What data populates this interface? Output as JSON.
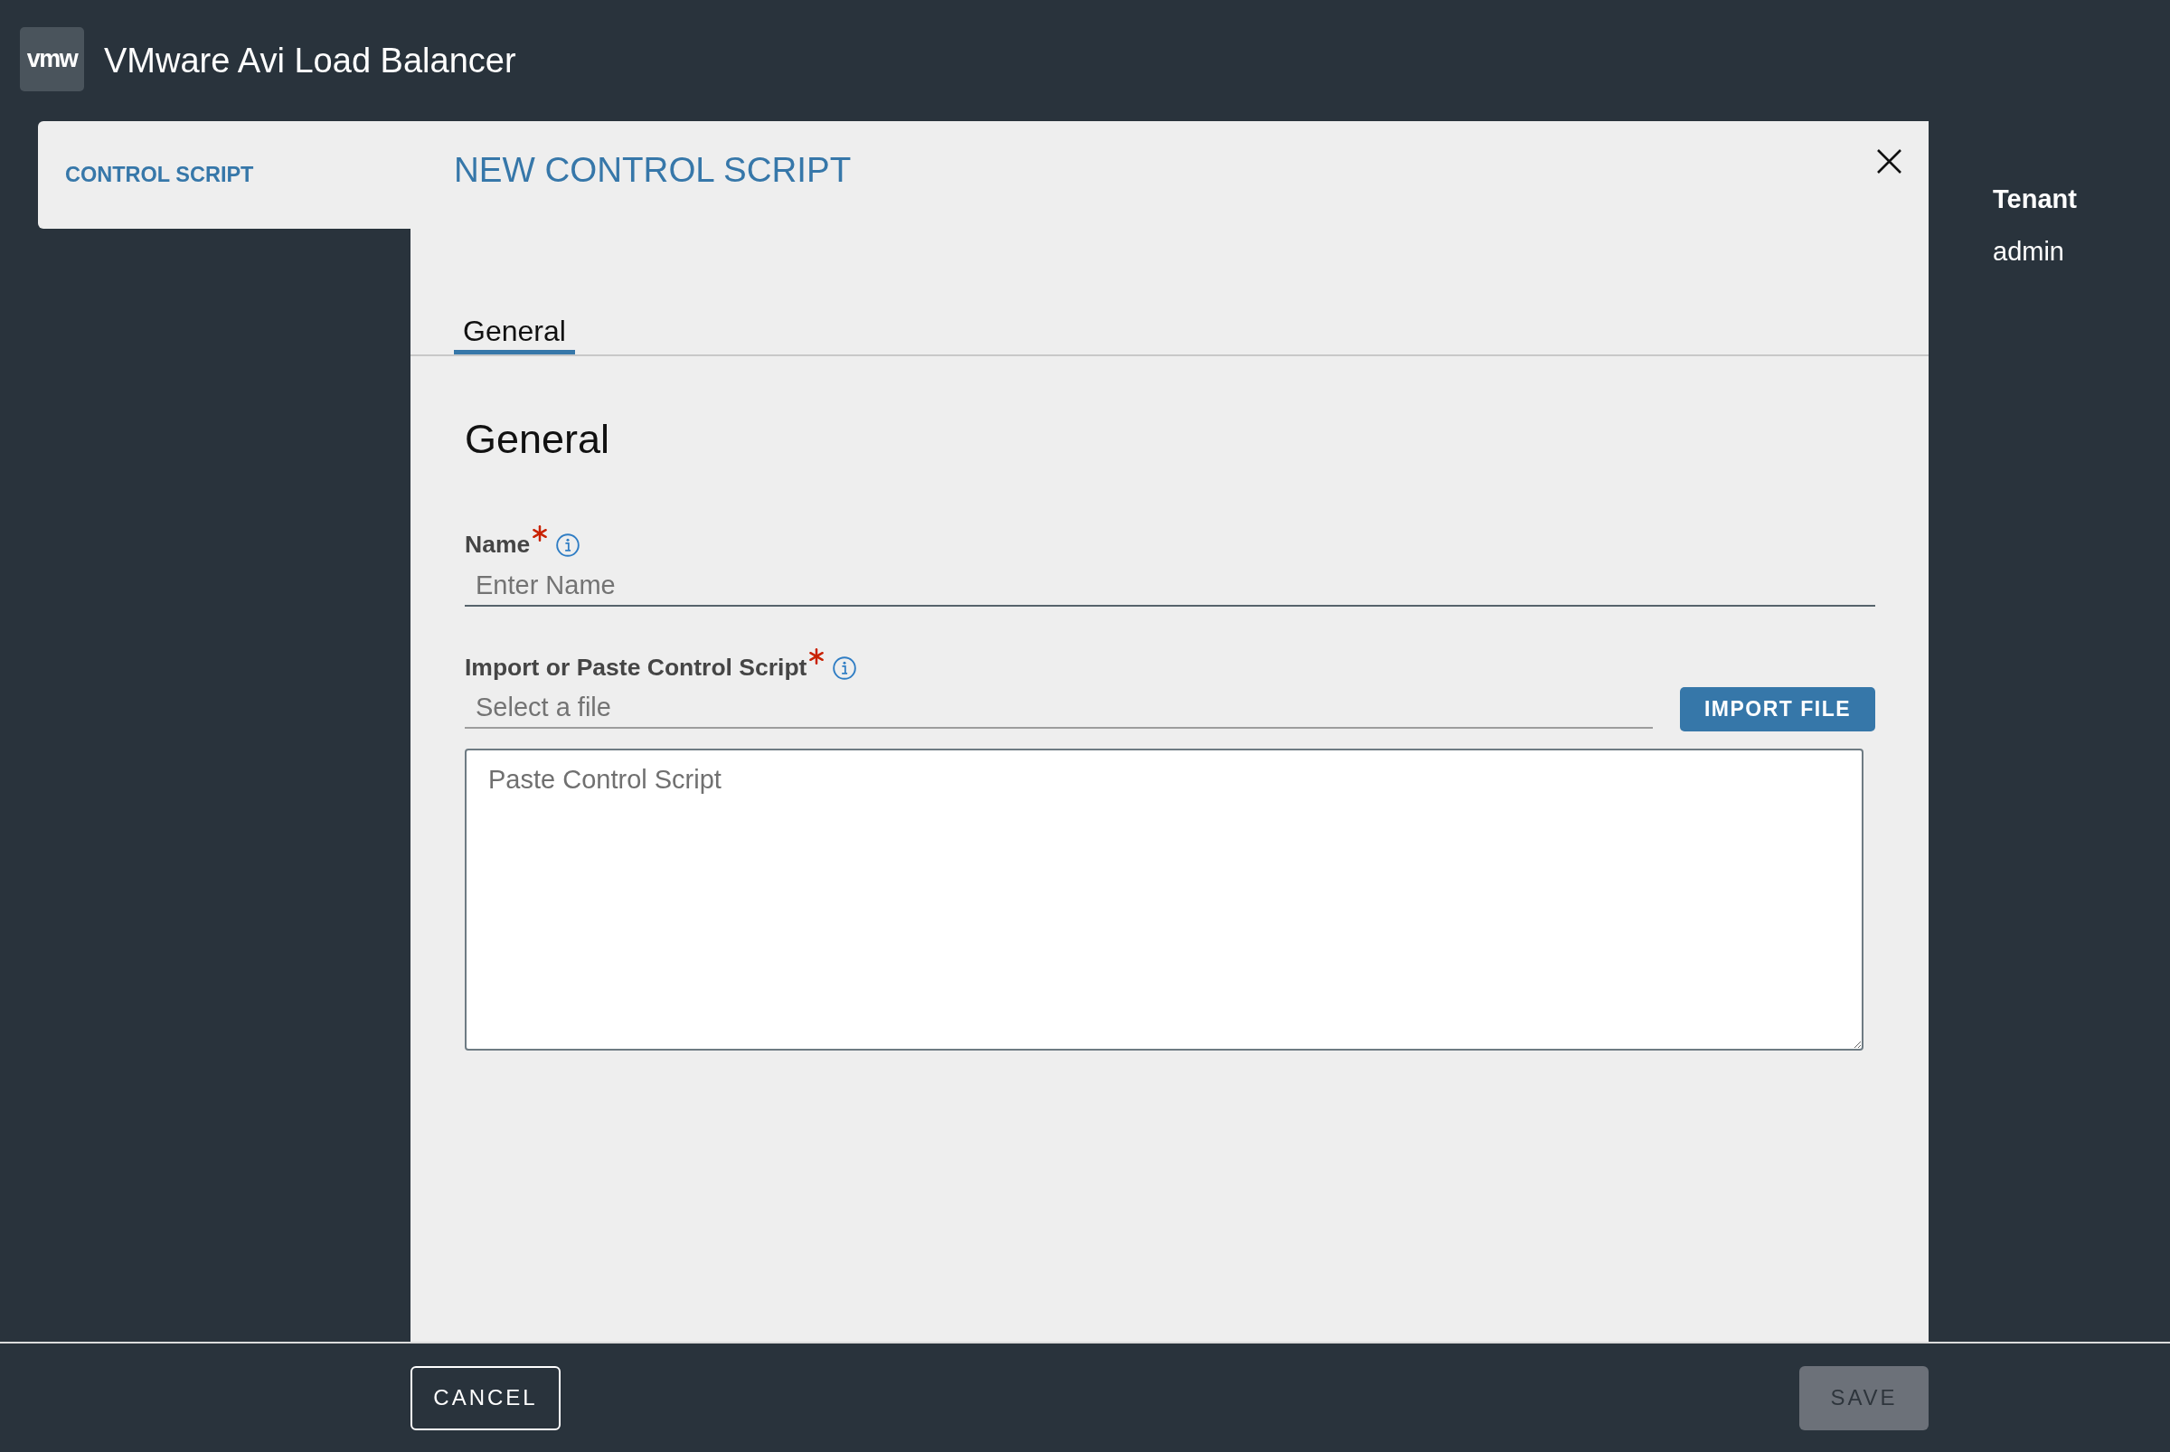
{
  "header": {
    "logo_text": "vmw",
    "title": "VMware Avi Load Balancer"
  },
  "side_tab": {
    "label": "CONTROL SCRIPT"
  },
  "modal": {
    "title": "NEW CONTROL SCRIPT",
    "tabs": [
      {
        "label": "General",
        "selected": true
      }
    ],
    "section_title": "General",
    "fields": [
      {
        "kind": "text",
        "label": "Name",
        "required": true,
        "placeholder": "Enter Name"
      },
      {
        "kind": "file",
        "label": "Import or Paste Control Script",
        "required": true,
        "placeholder": "Select a file",
        "button": "IMPORT FILE",
        "textarea": {
          "placeholder": "Paste Control Script"
        }
      }
    ]
  },
  "tenant": {
    "label": "Tenant",
    "value": "admin"
  },
  "footer": {
    "buttons": [
      {
        "kind": "outline",
        "label": "CANCEL",
        "disabled": false
      },
      {
        "kind": "primary",
        "label": "SAVE",
        "disabled": true
      }
    ]
  }
}
